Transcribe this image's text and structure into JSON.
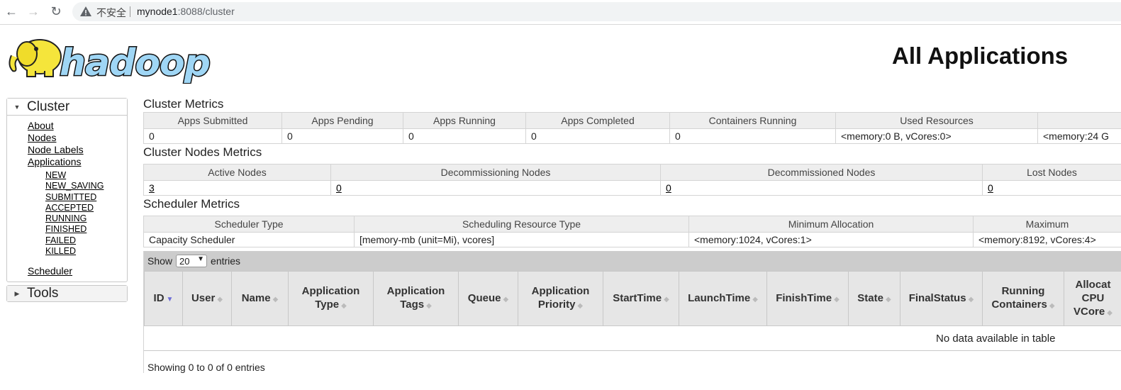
{
  "browser": {
    "insecure_label": "不安全",
    "url_host": "mynode1",
    "url_rest": ":8088/cluster"
  },
  "header": {
    "logo_text": "hadoop",
    "page_title": "All Applications"
  },
  "sidebar": {
    "cluster_title": "Cluster",
    "links": [
      "About",
      "Nodes",
      "Node Labels",
      "Applications"
    ],
    "app_states": [
      "NEW",
      "NEW_SAVING",
      "SUBMITTED",
      "ACCEPTED",
      "RUNNING",
      "FINISHED",
      "FAILED",
      "KILLED"
    ],
    "scheduler": "Scheduler",
    "tools_title": "Tools"
  },
  "cluster_metrics": {
    "title": "Cluster Metrics",
    "headers": [
      "Apps Submitted",
      "Apps Pending",
      "Apps Running",
      "Apps Completed",
      "Containers Running",
      "Used Resources",
      ""
    ],
    "values": [
      "0",
      "0",
      "0",
      "0",
      "0",
      "<memory:0 B, vCores:0>",
      "<memory:24 G"
    ]
  },
  "nodes_metrics": {
    "title": "Cluster Nodes Metrics",
    "headers": [
      "Active Nodes",
      "Decommissioning Nodes",
      "Decommissioned Nodes",
      "Lost Nodes"
    ],
    "values": [
      "3",
      "0",
      "0",
      "0"
    ]
  },
  "scheduler_metrics": {
    "title": "Scheduler Metrics",
    "headers": [
      "Scheduler Type",
      "Scheduling Resource Type",
      "Minimum Allocation",
      "Maximum"
    ],
    "values": [
      "Capacity Scheduler",
      "[memory-mb (unit=Mi), vcores]",
      "<memory:1024, vCores:1>",
      "<memory:8192, vCores:4>"
    ]
  },
  "apps_table": {
    "show_label": "Show",
    "page_size": "20",
    "entries_label": "entries",
    "columns": [
      {
        "lines": [
          "ID"
        ]
      },
      {
        "lines": [
          "User"
        ]
      },
      {
        "lines": [
          "Name"
        ]
      },
      {
        "lines": [
          "Application",
          "Type"
        ]
      },
      {
        "lines": [
          "Application",
          "Tags"
        ]
      },
      {
        "lines": [
          "Queue"
        ]
      },
      {
        "lines": [
          "Application",
          "Priority"
        ]
      },
      {
        "lines": [
          "StartTime"
        ]
      },
      {
        "lines": [
          "LaunchTime"
        ]
      },
      {
        "lines": [
          "FinishTime"
        ]
      },
      {
        "lines": [
          "State"
        ]
      },
      {
        "lines": [
          "FinalStatus"
        ]
      },
      {
        "lines": [
          "Running",
          "Containers"
        ]
      },
      {
        "lines": [
          "Allocat",
          "CPU",
          "VCore"
        ]
      }
    ],
    "empty_message": "No data available in table",
    "info": "Showing 0 to 0 of 0 entries"
  }
}
